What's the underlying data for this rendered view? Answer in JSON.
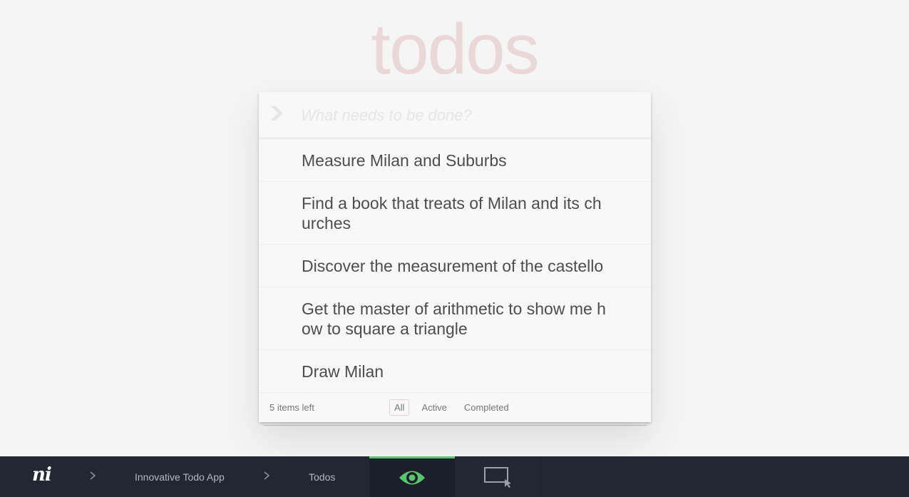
{
  "app": {
    "title": "todos"
  },
  "new_todo": {
    "placeholder": "What needs to be done?",
    "toggle_all_icon": "chevron-down-icon"
  },
  "todos": [
    {
      "text": "Measure Milan and Suburbs"
    },
    {
      "text": "Find a book that treats of Milan and its churches"
    },
    {
      "text": "Discover the measurement of the castello"
    },
    {
      "text": "Get the master of arithmetic to show me how to square a triangle"
    },
    {
      "text": "Draw Milan"
    }
  ],
  "footer": {
    "count": "5 items left",
    "filters": {
      "all": "All",
      "active": "Active",
      "completed": "Completed"
    },
    "selected_filter": "All"
  },
  "bottombar": {
    "logo": "ni",
    "breadcrumb": {
      "app": "Innovative Todo App",
      "page": "Todos"
    },
    "tabs": {
      "view": "eye-icon",
      "select": "select-rectangle-icon"
    },
    "colors": {
      "background": "#222733",
      "active_accent": "#5cc46e"
    }
  }
}
